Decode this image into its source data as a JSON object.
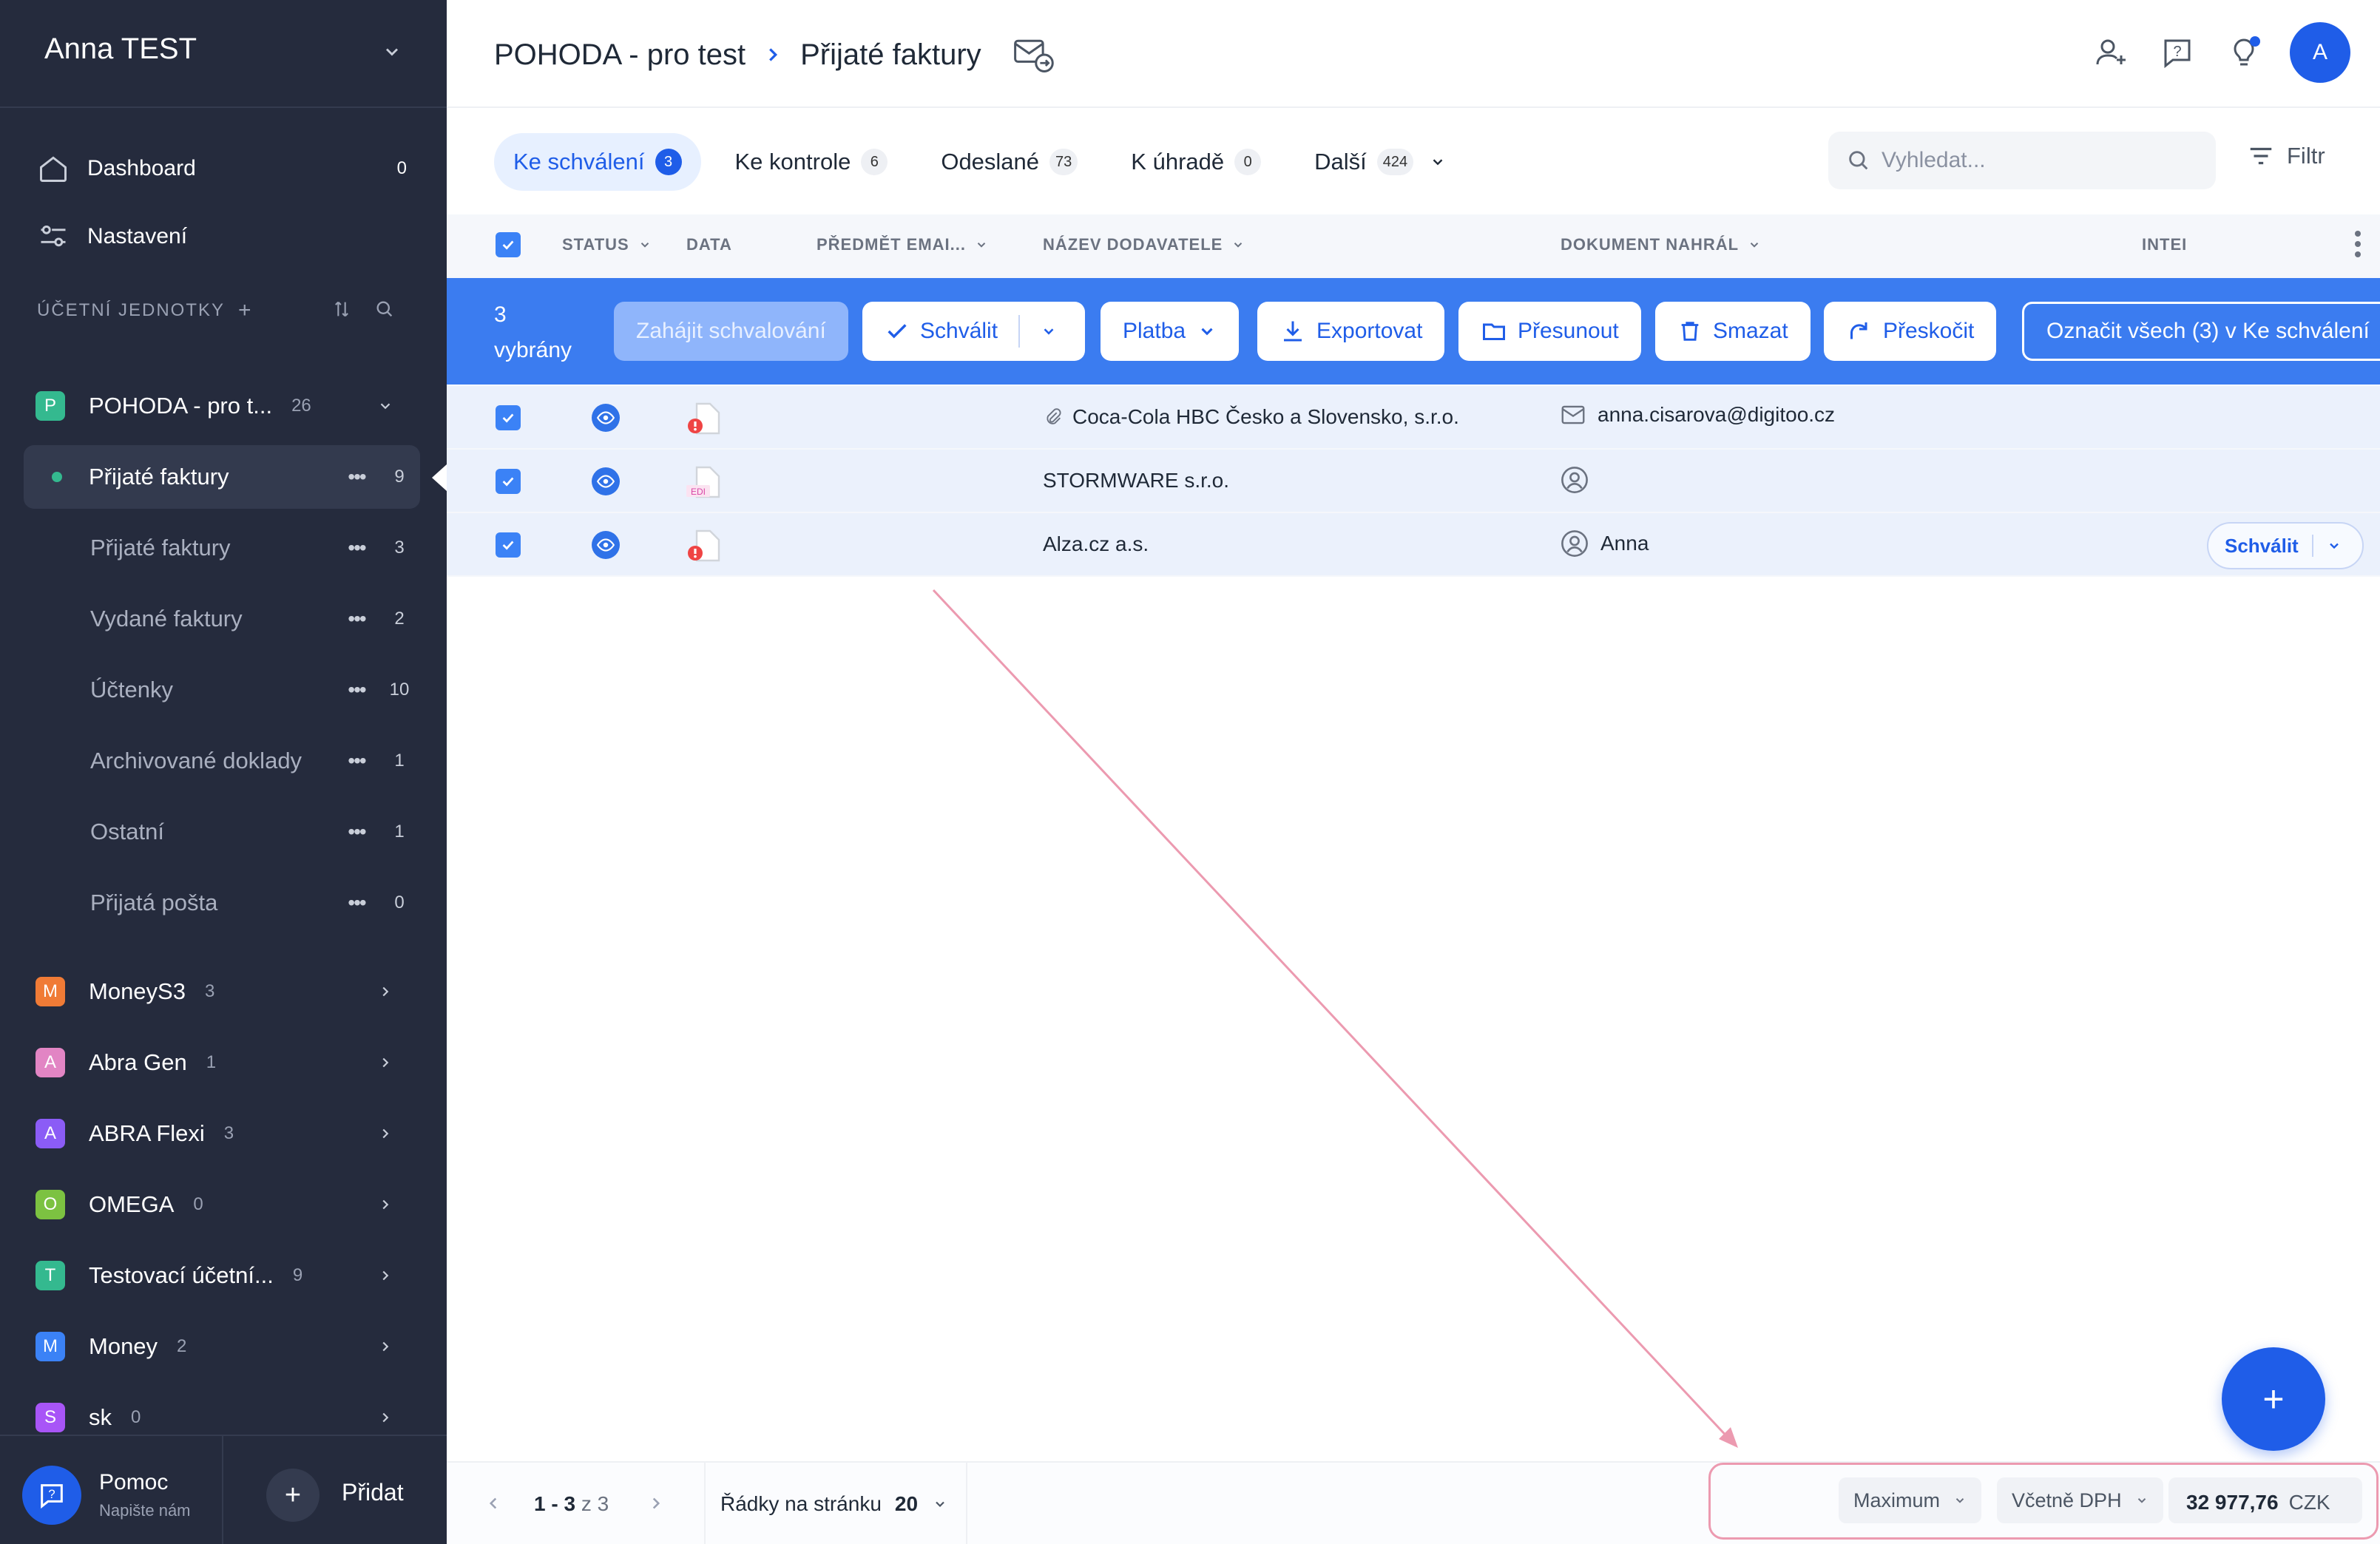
{
  "sidebar": {
    "user_name": "Anna TEST",
    "nav": [
      {
        "label": "Dashboard",
        "count": "0",
        "icon": "home-icon"
      },
      {
        "label": "Nastavení",
        "count": "",
        "icon": "settings-sliders-icon"
      }
    ],
    "section_label": "ÚČETNÍ JEDNOTKY",
    "active_unit": {
      "badge": "P",
      "label": "POHODA - pro t...",
      "count": "26",
      "color": "#34b98f"
    },
    "sub_items": [
      {
        "label": "Přijaté faktury",
        "count": "9",
        "active": true
      },
      {
        "label": "Přijaté faktury",
        "count": "3"
      },
      {
        "label": "Vydané faktury",
        "count": "2"
      },
      {
        "label": "Účtenky",
        "count": "10"
      },
      {
        "label": "Archivované doklady",
        "count": "1"
      },
      {
        "label": "Ostatní",
        "count": "1"
      },
      {
        "label": "Přijatá pošta",
        "count": "0"
      }
    ],
    "units": [
      {
        "badge": "M",
        "label": "MoneyS3",
        "count": "3",
        "color": "#f07b36"
      },
      {
        "badge": "A",
        "label": "Abra Gen",
        "count": "1",
        "color": "#e285c4"
      },
      {
        "badge": "A",
        "label": "ABRA Flexi",
        "count": "3",
        "color": "#8b5cf6"
      },
      {
        "badge": "O",
        "label": "OMEGA",
        "count": "0",
        "color": "#7cc241"
      },
      {
        "badge": "T",
        "label": "Testovací účetní...",
        "count": "9",
        "color": "#34b98f"
      },
      {
        "badge": "M",
        "label": "Money",
        "count": "2",
        "color": "#3b82f6"
      },
      {
        "badge": "S",
        "label": "sk",
        "count": "0",
        "color": "#a855f7"
      }
    ],
    "help_title": "Pomoc",
    "help_sub": "Napište nám",
    "add_label": "Přidat"
  },
  "header": {
    "company": "POHODA - pro test",
    "page": "Přijaté faktury",
    "avatar": "A"
  },
  "tabs": [
    {
      "label": "Ke schválení",
      "count": "3",
      "active": true
    },
    {
      "label": "Ke kontrole",
      "count": "6"
    },
    {
      "label": "Odeslané",
      "count": "73"
    },
    {
      "label": "K úhradě",
      "count": "0"
    },
    {
      "label": "Další",
      "count": "424"
    }
  ],
  "search": {
    "placeholder": "Vyhledat..."
  },
  "filter_label": "Filtr",
  "columns": {
    "status": "STATUS",
    "data": "DATA",
    "subject": "PŘEDMĚT EMAI...",
    "supplier": "NÁZEV DODAVATELE",
    "uploader": "DOKUMENT NAHRÁL",
    "integration": "INTEI"
  },
  "bulk": {
    "count_line1": "3",
    "count_line2": "vybrány",
    "start_approval": "Zahájit schvalování",
    "approve": "Schválit",
    "payment": "Platba",
    "export": "Exportovat",
    "move": "Přesunout",
    "delete": "Smazat",
    "skip": "Přeskočit",
    "mark_all": "Označit všech (3) v Ke schválení"
  },
  "rows": [
    {
      "supplier": "Coca-Cola HBC Česko a Slovensko, s.r.o.",
      "uploader": "anna.cisarova@digitoo.cz",
      "doc": "error",
      "uploader_icon": "mail-icon",
      "attachment": true
    },
    {
      "supplier": "STORMWARE s.r.o.",
      "uploader": "",
      "doc": "edi",
      "uploader_icon": "user-circle-icon"
    },
    {
      "supplier": "Alza.cz a.s.",
      "uploader": "Anna",
      "doc": "error",
      "uploader_icon": "user-circle-icon",
      "row_action": "Schválit"
    }
  ],
  "edi_label": "EDI",
  "footer": {
    "range": "1 - 3",
    "of": "z 3",
    "rows_per_page_label": "Řádky na stránku",
    "rows_per_page": "20",
    "aggregate": "Maximum",
    "vat": "Včetně DPH",
    "total": "32 977,76",
    "currency": "CZK"
  },
  "fab_label": "+",
  "colors": {
    "accent": "#1f5de8",
    "sidebar_bg": "#252b3d",
    "bulk_bar": "#3b7cf0",
    "annotation": "#ec9ab0"
  }
}
